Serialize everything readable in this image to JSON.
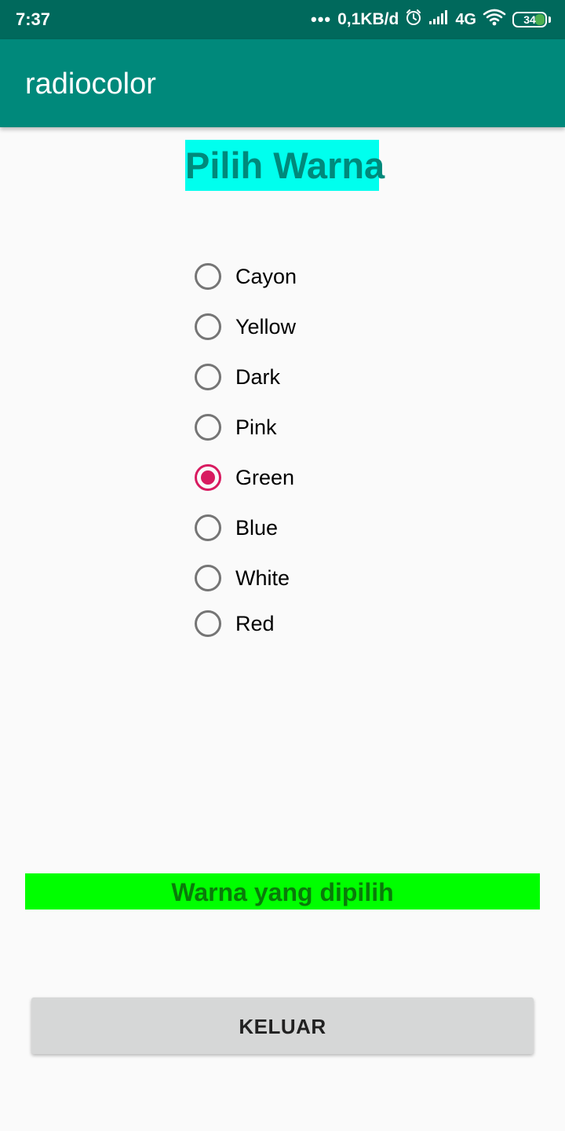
{
  "status_bar": {
    "time": "7:37",
    "dots": "•••",
    "net_speed": "0,1KB/d",
    "network_type": "4G",
    "battery": "34",
    "battery_level_percent": 34,
    "icons": [
      "more-dots-icon",
      "alarm-icon",
      "signal-icon",
      "wifi-icon",
      "battery-icon"
    ]
  },
  "app_bar": {
    "title": "radiocolor"
  },
  "heading": {
    "text": "Pilih Warna"
  },
  "radio_group": {
    "options": [
      {
        "label": "Cayon",
        "checked": false
      },
      {
        "label": "Yellow",
        "checked": false
      },
      {
        "label": "Dark",
        "checked": false
      },
      {
        "label": "Pink",
        "checked": false
      },
      {
        "label": "Green",
        "checked": true
      },
      {
        "label": "Blue",
        "checked": false
      },
      {
        "label": "White",
        "checked": false
      },
      {
        "label": "Red",
        "checked": false
      }
    ]
  },
  "result": {
    "text": "Warna yang dipilih"
  },
  "exit_button": {
    "label": "KELUAR"
  },
  "colors": {
    "status_bar": "#00695c",
    "app_bar": "#00897b",
    "heading_bg": "#00ffee",
    "heading_text": "#00897b",
    "radio_accent": "#d81b60",
    "radio_unchecked": "#757575",
    "result_bg": "#00ff00",
    "result_text": "#0a7a0a",
    "button_bg": "#d6d7d7",
    "page_bg": "#fafafa"
  }
}
